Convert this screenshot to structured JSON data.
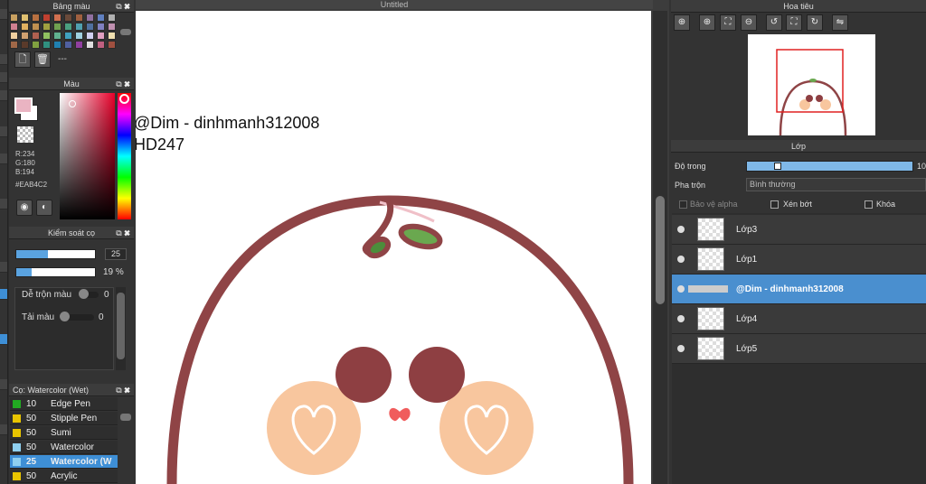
{
  "palette": {
    "title": "Bảng màu",
    "bottom_text": "---",
    "swatches": [
      "#c8a060",
      "#e0c070",
      "#b87040",
      "#c04030",
      "#d07050",
      "#6a4a3a",
      "#a06040",
      "#9070a0",
      "#6080c0",
      "#b0b0b0",
      "#d08090",
      "#e0b060",
      "#c09050",
      "#a0a040",
      "#70a050",
      "#4aa080",
      "#50a0b0",
      "#5070a0",
      "#8080c0",
      "#c090b0",
      "#f0d0a0",
      "#d0a070",
      "#b06050",
      "#90c060",
      "#60b090",
      "#40a0c0",
      "#a0d0e0",
      "#d0d0f0",
      "#e0a0c0",
      "#f0e0b0",
      "#a06848",
      "#5a3a2a",
      "#80a040",
      "#309080",
      "#2080b0",
      "#5060a0",
      "#9040a0",
      "#e0e0e0",
      "#c06080",
      "#a05040"
    ]
  },
  "color": {
    "title": "Màu",
    "r": "R:234",
    "g": "G:180",
    "b": "B:194",
    "hex": "#EAB4C2",
    "current": "#EAB4C2"
  },
  "brush_control": {
    "title": "Kiểm soát cọ",
    "size_value": "25",
    "size_fill": 0.4,
    "opacity_value": "19 %",
    "opacity_fill": 0.19,
    "blend_label": "Dễ trộn màu",
    "blend_value": "0",
    "reload_label": "Tải màu",
    "reload_value": "0"
  },
  "brushes": {
    "title": "Cọ: Watercolor (Wet)",
    "items": [
      {
        "size": "10",
        "name": "Edge Pen",
        "color": "#22aa22",
        "selected": false
      },
      {
        "size": "50",
        "name": "Stipple Pen",
        "color": "#e8c400",
        "selected": false
      },
      {
        "size": "50",
        "name": "Sumi",
        "color": "#e8c400",
        "selected": false
      },
      {
        "size": "50",
        "name": "Watercolor",
        "color": "#8fd0f0",
        "selected": false
      },
      {
        "size": "25",
        "name": "Watercolor (W",
        "color": "#8fd0f0",
        "selected": true
      },
      {
        "size": "50",
        "name": "Acrylic",
        "color": "#e8c400",
        "selected": false
      }
    ]
  },
  "canvas": {
    "tab_title": "Untitled",
    "text_line1": "@Dim - dinhmanh312008",
    "text_line2": "HD247"
  },
  "navigator": {
    "title": "Hoa tiêu",
    "buttons": [
      "zoom-fit-icon",
      "zoom-in-icon",
      "actual-size-icon",
      "zoom-out-icon",
      "rotate-left-icon",
      "fit-window-icon",
      "rotate-right-icon",
      "flip-icon"
    ]
  },
  "layers": {
    "title": "Lớp",
    "opacity_label": "Độ trong",
    "opacity_value": "10",
    "opacity_fill": 0.95,
    "blend_label": "Pha trộn",
    "blend_value": "Bình thường",
    "protect_alpha": "Bảo vệ alpha",
    "clipping": "Xén bớt",
    "lock": "Khóa",
    "items": [
      {
        "name": "Lớp3",
        "selected": false
      },
      {
        "name": "Lớp1",
        "selected": false
      },
      {
        "name": "@Dim - dinhmanh312008",
        "selected": true
      },
      {
        "name": "Lớp4",
        "selected": false
      },
      {
        "name": "Lớp5",
        "selected": false
      }
    ]
  }
}
